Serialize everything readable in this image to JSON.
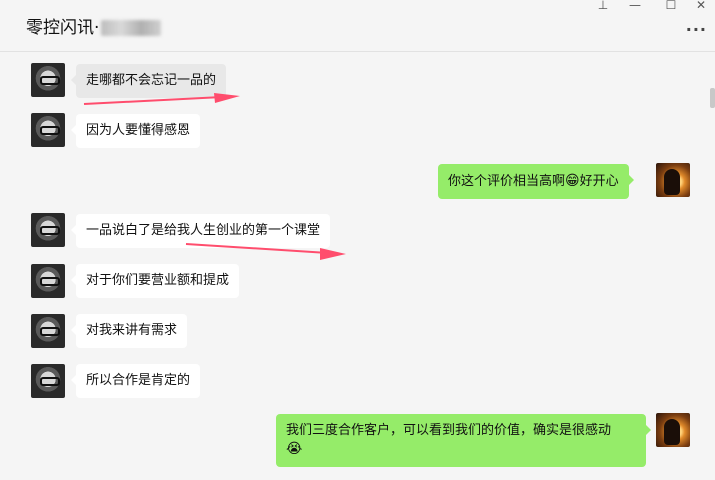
{
  "window": {
    "title": "零控闪讯·",
    "controls": {
      "pin": "⊥",
      "minimize": "—",
      "maximize": "☐",
      "close": "✕"
    },
    "more_label": "···"
  },
  "messages": [
    {
      "side": "left",
      "text": "走哪都不会忘记一品的"
    },
    {
      "side": "left",
      "text": "因为人要懂得感恩"
    },
    {
      "side": "right",
      "text_before": "你这个评价相当高啊",
      "emoji": "😁",
      "text_after": "好开心"
    },
    {
      "side": "left",
      "text": "一品说白了是给我人生创业的第一个课堂"
    },
    {
      "side": "left",
      "text": "对于你们要营业额和提成"
    },
    {
      "side": "left",
      "text": "对我来讲有需求"
    },
    {
      "side": "left",
      "text": "所以合作是肯定的"
    },
    {
      "side": "right",
      "text_before": "我们三度合作客户，可以看到我们的价值，确实是很感动",
      "emoji": "😭",
      "text_after": ""
    }
  ],
  "annotation_color": "#ff4d6d"
}
